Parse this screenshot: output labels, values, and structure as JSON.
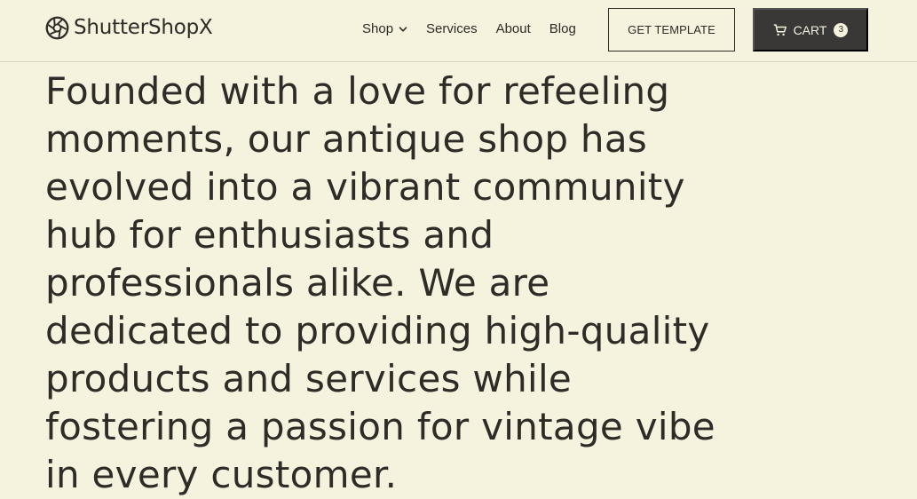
{
  "brand": {
    "name": "ShutterShopX",
    "logo_icon": "camera-aperture-icon"
  },
  "nav": {
    "items": [
      {
        "label": "Shop",
        "icon": "chevron-down-icon"
      },
      {
        "label": "Services"
      },
      {
        "label": "About"
      },
      {
        "label": "Blog"
      }
    ]
  },
  "actions": {
    "template_label": "GET TEMPLATE",
    "cart_label": "CART",
    "cart_count": "3",
    "cart_icon": "cart-icon"
  },
  "hero": {
    "lines": [
      "Founded with a love for refeeling",
      "moments, our antique shop has",
      "evolved into a vibrant community",
      "hub for enthusiasts and",
      "professionals alike. We are",
      "dedicated to providing high-quality",
      "products and services while",
      "fostering a passion for vintage vibe",
      "in every customer."
    ]
  },
  "colors": {
    "background": "#f5f2de",
    "text": "#2f2b27",
    "cart_button": "#3a3836"
  }
}
